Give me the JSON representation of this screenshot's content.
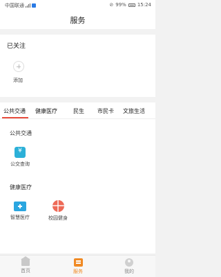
{
  "statusbar": {
    "carrier": "中国联通",
    "battery": "99%",
    "time": "15:24"
  },
  "header": {
    "title": "服务"
  },
  "followed": {
    "title": "已关注",
    "add_label": "添加"
  },
  "tabs": [
    {
      "label": "公共交通",
      "active": true
    },
    {
      "label": "健康医疗",
      "active": false
    },
    {
      "label": "民生",
      "active": false
    },
    {
      "label": "市民卡",
      "active": false
    },
    {
      "label": "文旅生活",
      "active": false
    }
  ],
  "sections": [
    {
      "title": "公共交通",
      "items": [
        {
          "label": "公交查询",
          "icon": "bus-query-icon"
        }
      ]
    },
    {
      "title": "健康医疗",
      "items": [
        {
          "label": "智慧医疗",
          "icon": "medical-kit-icon"
        },
        {
          "label": "校园健身",
          "icon": "ball-icon"
        }
      ]
    }
  ],
  "bottom_nav": [
    {
      "label": "首页",
      "icon": "home-icon",
      "active": false
    },
    {
      "label": "服务",
      "icon": "service-icon",
      "active": true
    },
    {
      "label": "我的",
      "icon": "profile-icon",
      "active": false
    }
  ],
  "colors": {
    "accent": "#f08a24",
    "tab_indicator": "#e84c3d",
    "icon_teal": "#2cb0d8",
    "icon_red": "#ee6a57"
  }
}
